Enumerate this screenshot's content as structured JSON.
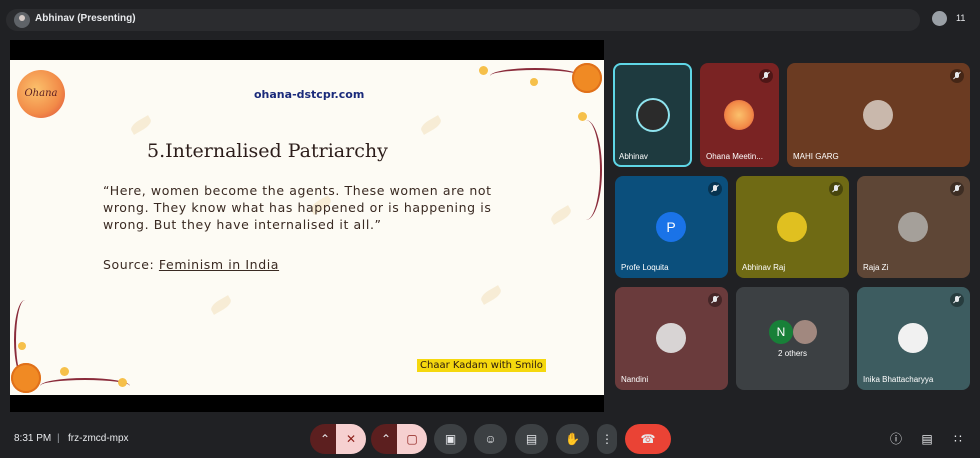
{
  "topbar": {
    "presenter_label": "Abhinav (Presenting)",
    "participant_count": "11"
  },
  "slide": {
    "logo_text": "Ohana",
    "site": "ohana-dstcpr.com",
    "title": "5.Internalised Patriarchy",
    "quote": "“Here, women become the agents. These women are not wrong. They know what has happened or is happening is wrong. But they have internalised it all.”",
    "source_prefix": "Source: ",
    "source_link": "Feminism in India",
    "caption": "Chaar Kadam with Smilo"
  },
  "tiles": [
    {
      "name": "Abhinav",
      "bg": "#1e3a3f",
      "muted": false,
      "active": true
    },
    {
      "name": "Ohana Meetin...",
      "bg": "#7a2323",
      "muted": true
    },
    {
      "name": "MAHI GARG",
      "bg": "#6b3b22",
      "muted": true
    },
    {
      "name": "Profe Loquita",
      "bg": "#0b4f7c",
      "muted": true,
      "initial": "P"
    },
    {
      "name": "Abhinav Raj",
      "bg": "#6f6a14",
      "muted": true
    },
    {
      "name": "Raja Zi",
      "bg": "#5e4636",
      "muted": true
    },
    {
      "name": "Nandini",
      "bg": "#6a3b3c",
      "muted": true
    },
    {
      "name": "2 others",
      "bg": "#3c4043",
      "initial": "N"
    },
    {
      "name": "Inika Bhattacharyya",
      "bg": "#3d5c60",
      "muted": true
    }
  ],
  "bottom": {
    "time": "8:31 PM",
    "separator": "|",
    "meeting_code": "frz-zmcd-mpx"
  },
  "colors": {
    "hangup": "#ea4335",
    "active_border": "#5fd6e6",
    "muted_mic_bg": "#f6d0d0"
  }
}
